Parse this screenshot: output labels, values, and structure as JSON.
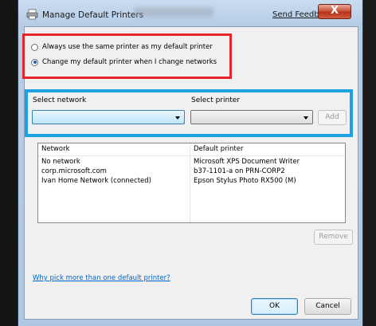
{
  "window": {
    "title": "Manage Default Printers",
    "feedback_label": "Send Feedback",
    "close_label": "X"
  },
  "mode": {
    "options": [
      {
        "label": "Always use the same printer as my default printer",
        "checked": false
      },
      {
        "label": "Change my default printer when I change networks",
        "checked": true
      }
    ]
  },
  "selectors": {
    "network_label": "Select network",
    "network_value": "",
    "printer_label": "Select printer",
    "printer_value": "",
    "add_label": "Add"
  },
  "table": {
    "columns": [
      "Network",
      "Default printer"
    ],
    "rows": [
      [
        "No network",
        "Microsoft XPS Document Writer"
      ],
      [
        "corp.microsoft.com",
        "b37-1101-a on PRN-CORP2"
      ],
      [
        "Ivan Home Network (connected)",
        "Epson Stylus Photo RX500 (M)"
      ]
    ]
  },
  "remove_label": "Remove",
  "help_link": "Why pick more than one default printer?",
  "footer": {
    "ok_label": "OK",
    "cancel_label": "Cancel"
  },
  "colors": {
    "highlight_red": "#e3262d",
    "highlight_blue": "#1da1e0",
    "link": "#0066cc"
  }
}
